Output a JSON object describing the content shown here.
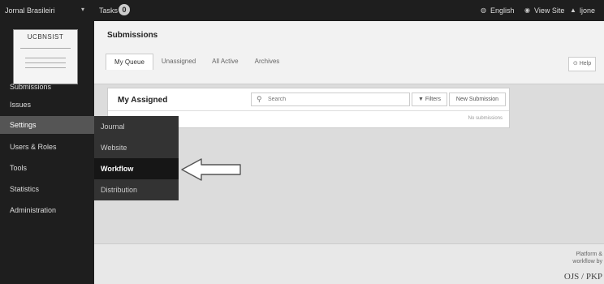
{
  "topbar": {
    "journal_name": "Jornal Brasileiri",
    "tasks_label": "Tasks",
    "tasks_count": "0",
    "language_label": "English",
    "view_site_label": "View Site",
    "user_label": "ljone"
  },
  "sidebar": {
    "logo_text": "UCBNSIST",
    "items": [
      {
        "label": "Submissions"
      },
      {
        "label": "Issues"
      },
      {
        "label": "Settings"
      },
      {
        "label": "Users & Roles"
      },
      {
        "label": "Tools"
      },
      {
        "label": "Statistics"
      },
      {
        "label": "Administration"
      }
    ],
    "settings_submenu": [
      {
        "label": "Journal"
      },
      {
        "label": "Website"
      },
      {
        "label": "Workflow"
      },
      {
        "label": "Distribution"
      }
    ]
  },
  "main": {
    "page_title": "Submissions",
    "tabs": [
      {
        "label": "My Queue"
      },
      {
        "label": "Unassigned"
      },
      {
        "label": "All Active"
      },
      {
        "label": "Archives"
      }
    ],
    "help_label": "Help",
    "panel": {
      "title": "My Assigned",
      "search_placeholder": "Search",
      "filters_label": "Filters",
      "new_submission_label": "New Submission",
      "no_items_text": "No submissions"
    }
  },
  "footer": {
    "line1": "Platform &",
    "line2": "workflow by",
    "logo": "OJS / PKP"
  },
  "colors": {
    "sidebar_bg": "#1e1e1e",
    "active_nav": "#555555",
    "flyout_bg": "#333333",
    "flyout_active": "#161616"
  }
}
